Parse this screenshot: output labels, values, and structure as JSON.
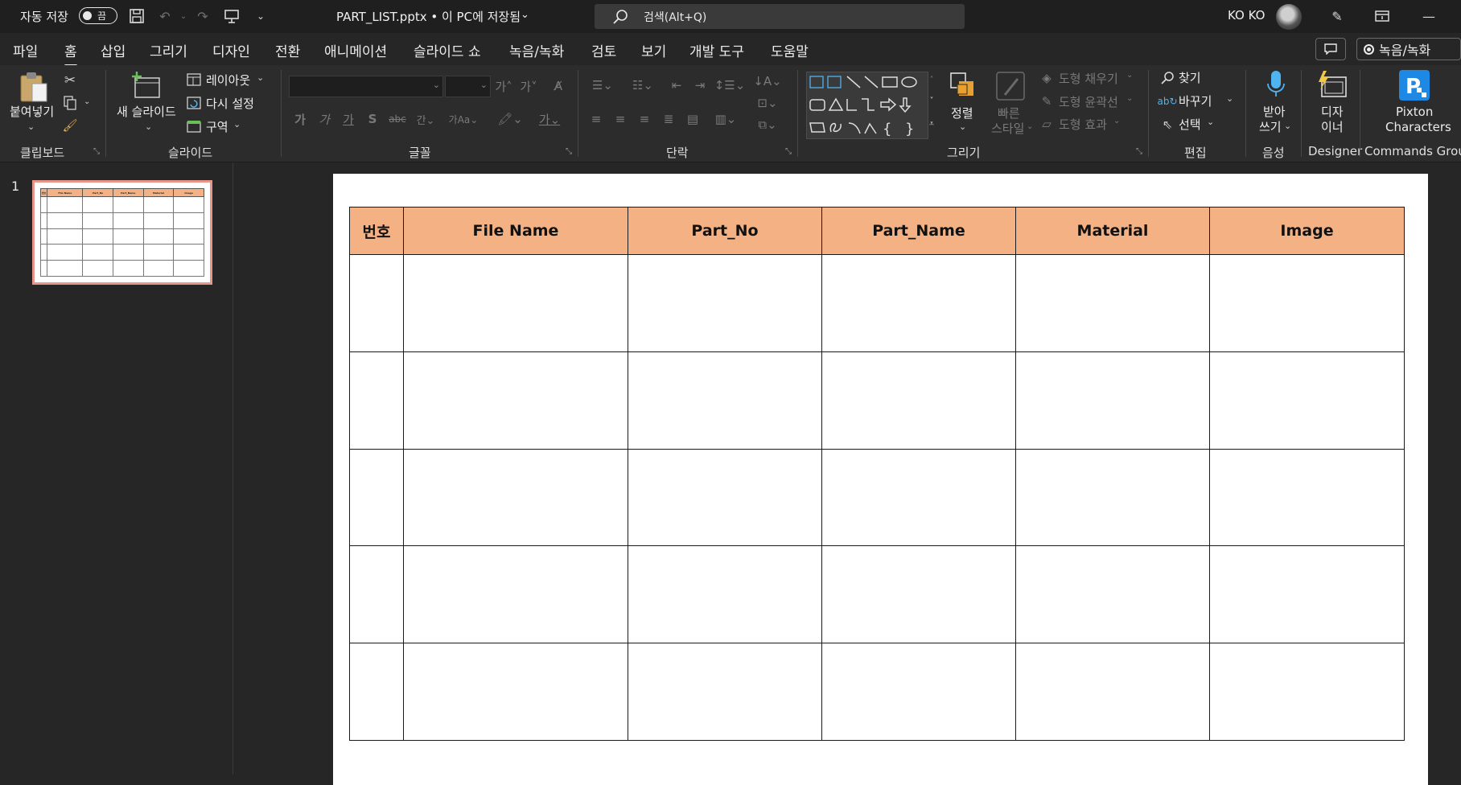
{
  "titlebar": {
    "autosave_label": "자동 저장",
    "autosave_state": "끔",
    "document_title": "PART_LIST.pptx • 이 PC에 저장됨",
    "search_placeholder": "검색(Alt+Q)",
    "user_initials": "KO KO"
  },
  "menu": {
    "tabs": [
      "파일",
      "홈",
      "삽입",
      "그리기",
      "디자인",
      "전환",
      "애니메이션",
      "슬라이드 쇼",
      "녹음/녹화",
      "검토",
      "보기",
      "개발 도구",
      "도움말"
    ],
    "active_tab": "홈",
    "record_button": "녹음/녹화"
  },
  "ribbon": {
    "clipboard": {
      "paste": "붙여넣기",
      "group": "클립보드"
    },
    "slides": {
      "new_slide": "새 슬라이드",
      "layout": "레이아웃",
      "reset": "다시 설정",
      "section": "구역",
      "group": "슬라이드"
    },
    "font": {
      "group": "글꼴"
    },
    "paragraph": {
      "group": "단락"
    },
    "drawing": {
      "arrange": "정렬",
      "quick_styles_1": "빠른",
      "quick_styles_2": "스타일",
      "shape_fill": "도형 채우기",
      "shape_outline": "도형 윤곽선",
      "shape_effects": "도형 효과",
      "group": "그리기"
    },
    "editing": {
      "find": "찾기",
      "replace": "바꾸기",
      "select": "선택",
      "group": "편집"
    },
    "voice": {
      "dictate_1": "받아",
      "dictate_2": "쓰기",
      "group": "음성"
    },
    "designer": {
      "label_1": "디자",
      "label_2": "이너",
      "group": "Designer"
    },
    "pixton": {
      "label_1": "Pixton",
      "label_2": "Characters",
      "group": "Commands Group"
    }
  },
  "thumbnails": {
    "slide_number": "1"
  },
  "slide": {
    "table": {
      "headers": [
        "번호",
        "File Name",
        "Part_No",
        "Part_Name",
        "Material",
        "Image"
      ],
      "rows": [
        [
          "",
          "",
          "",
          "",
          "",
          ""
        ],
        [
          "",
          "",
          "",
          "",
          "",
          ""
        ],
        [
          "",
          "",
          "",
          "",
          "",
          ""
        ],
        [
          "",
          "",
          "",
          "",
          "",
          ""
        ],
        [
          "",
          "",
          "",
          "",
          "",
          ""
        ]
      ],
      "header_color": "#f4b183"
    }
  },
  "colors": {
    "accent_pptx": "#c43e1c",
    "thumb_selected_border": "#e8968a",
    "header_fill": "#f4b183"
  }
}
